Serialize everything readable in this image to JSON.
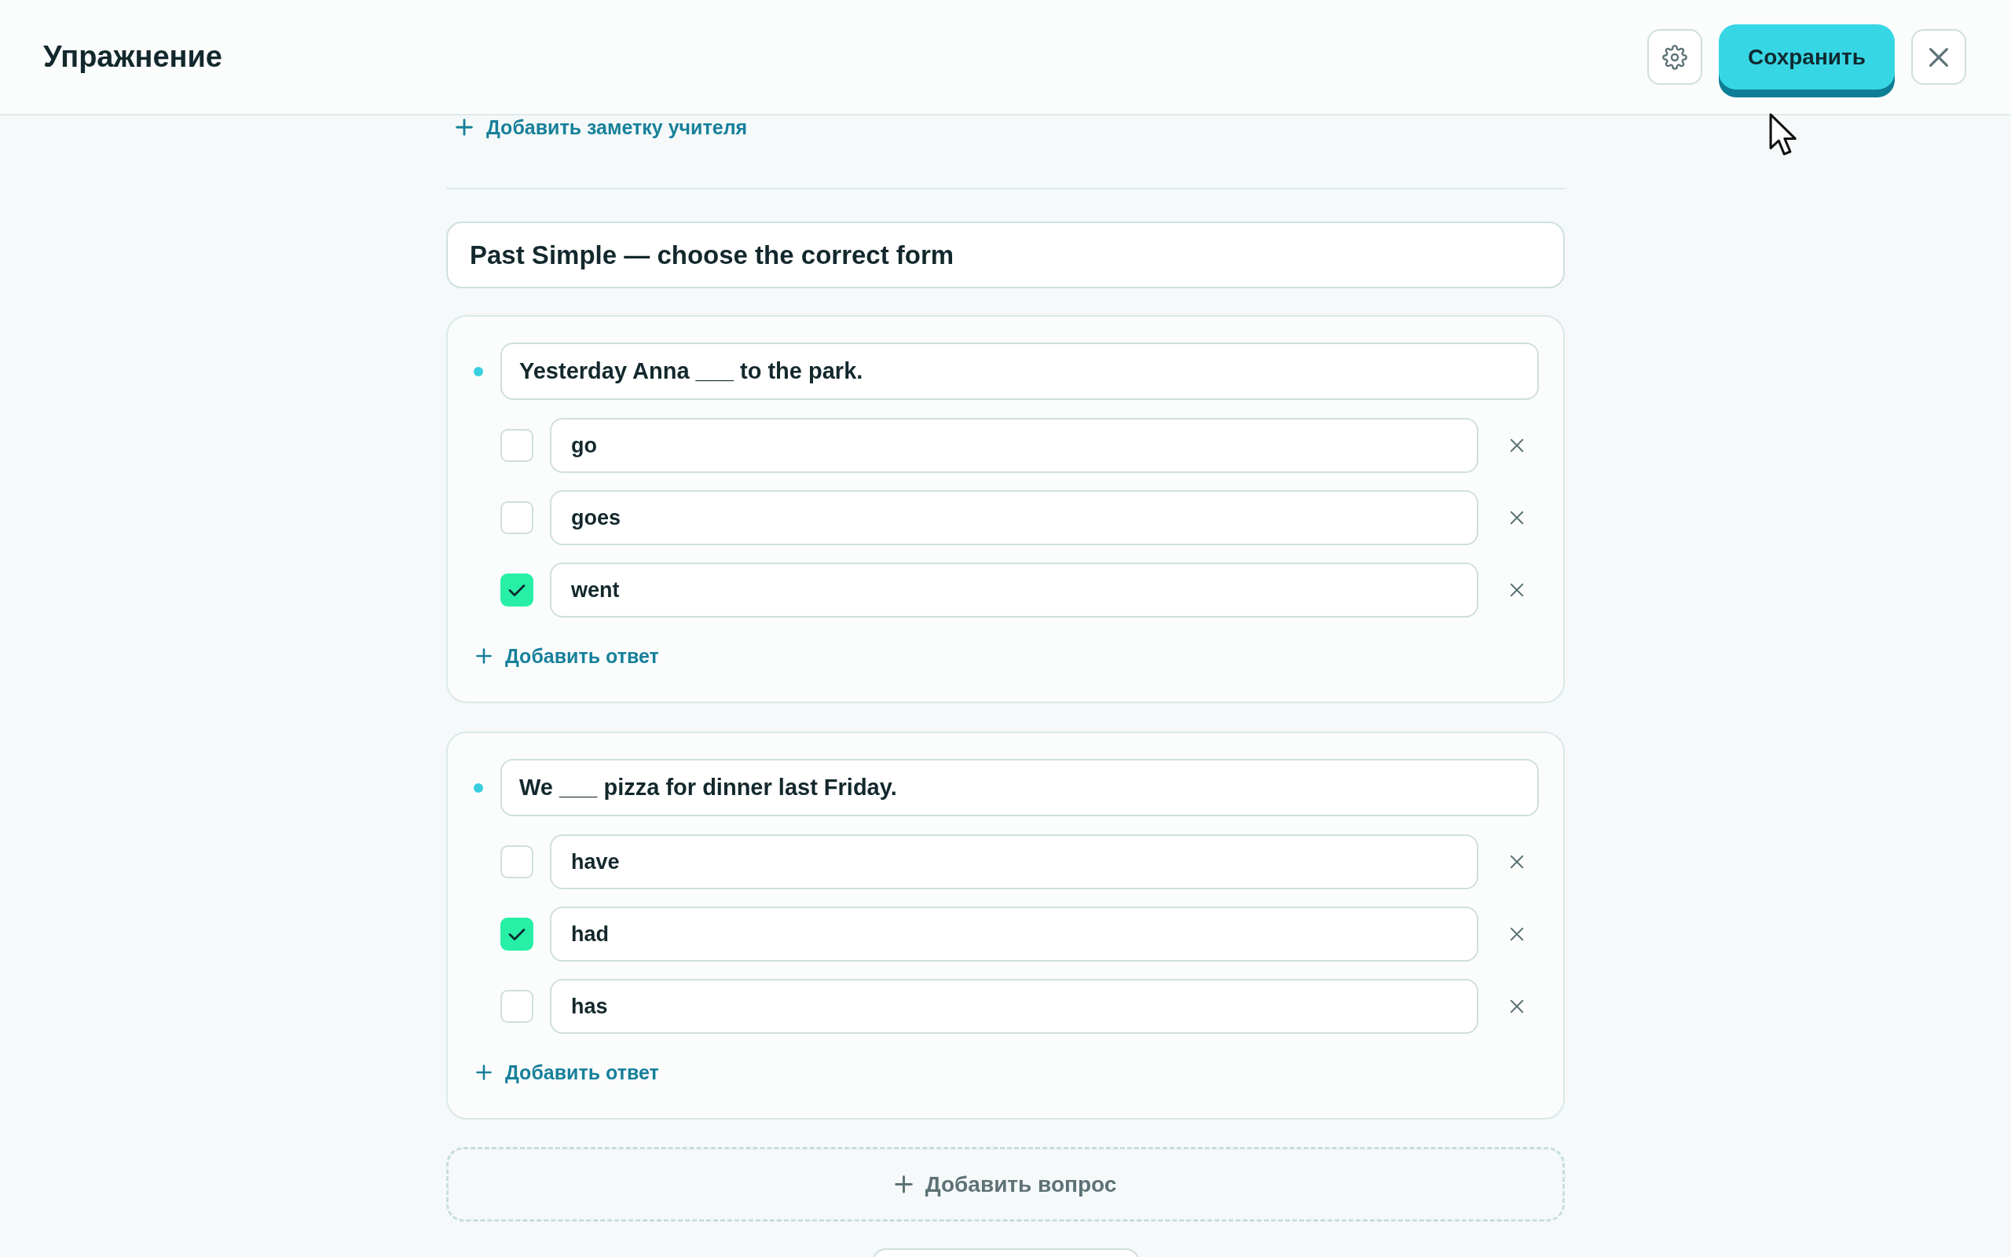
{
  "header": {
    "title": "Упражнение",
    "save_button": "Сохранить"
  },
  "teacher_note": {
    "label": "Добавить заметку учителя"
  },
  "exercise": {
    "title": "Past Simple — choose the correct form"
  },
  "questions": [
    {
      "text": "Yesterday Anna ___ to the park.",
      "answers": [
        {
          "text": "go",
          "checked": false
        },
        {
          "text": "goes",
          "checked": false
        },
        {
          "text": "went",
          "checked": true
        }
      ],
      "add_answer": "Добавить ответ"
    },
    {
      "text": "We ___ pizza for dinner last Friday.",
      "answers": [
        {
          "text": "have",
          "checked": false
        },
        {
          "text": "had",
          "checked": true
        },
        {
          "text": "has",
          "checked": false
        }
      ],
      "add_answer": "Добавить ответ"
    }
  ],
  "add_question": "Добавить вопрос"
}
